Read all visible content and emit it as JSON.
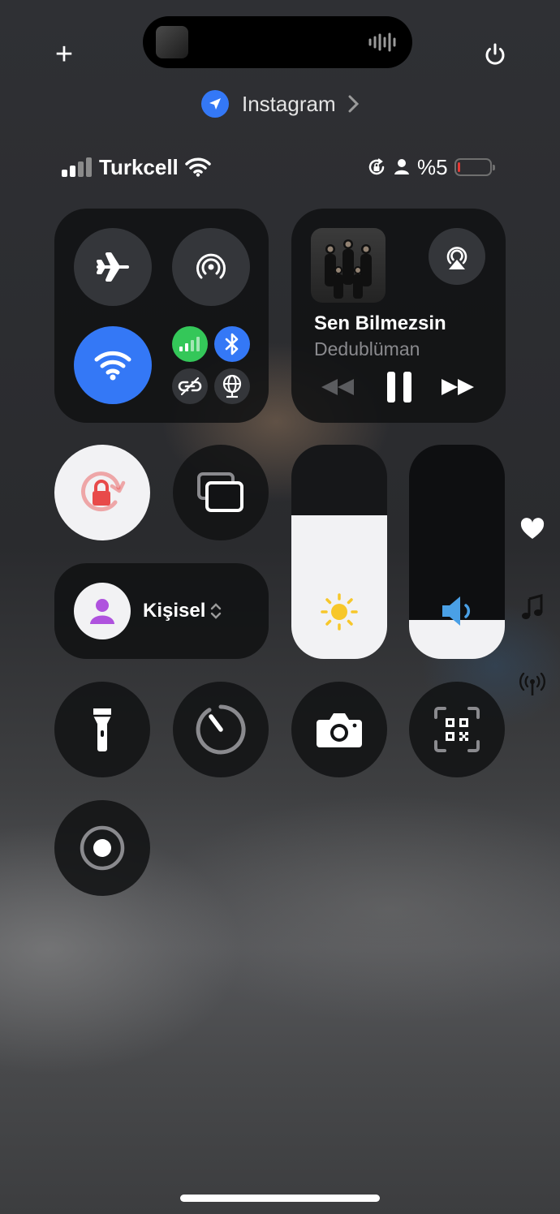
{
  "top_bar": {
    "add_label": "+",
    "power_icon": "power-icon"
  },
  "dynamic_island": {
    "artwork_icon": "album-artwork",
    "waveform_icon": "waveform-icon"
  },
  "location": {
    "app_name": "Instagram",
    "icon": "location-arrow-icon"
  },
  "status_bar": {
    "carrier": "Turkcell",
    "battery_text": "%5",
    "battery_level_percent": 5,
    "battery_color": "#e53935"
  },
  "connectivity": {
    "airplane_icon": "airplane-icon",
    "airdrop_icon": "airdrop-icon",
    "wifi_icon": "wifi-icon",
    "cellular_icon": "cellular-icon",
    "bluetooth_icon": "bluetooth-icon",
    "hotspot_icon": "personal-hotspot-icon",
    "vpn_icon": "vpn-globe-icon",
    "wifi_color": "#3478f6",
    "cellular_color": "#34c759",
    "bluetooth_color": "#3478f6"
  },
  "now_playing": {
    "title": "Sen Bilmezsin",
    "artist": "Dedublüman",
    "airplay_icon": "airplay-icon",
    "prev_icon": "rewind-icon",
    "play_icon": "pause-icon",
    "next_icon": "fast-forward-icon"
  },
  "focus": {
    "label": "Kişisel",
    "icon": "person-icon",
    "accent": "#af52de"
  },
  "sliders": {
    "brightness_level_percent": 67,
    "volume_level_percent": 18,
    "brightness_icon": "sun-icon",
    "volume_icon": "speaker-icon"
  },
  "side_icons": [
    "heart-icon",
    "music-note-icon",
    "antenna-icon"
  ],
  "controls": [
    "flashlight-icon",
    "timer-icon",
    "camera-icon",
    "qr-code-icon",
    "screen-record-icon"
  ],
  "rotation_lock": {
    "icon": "rotation-lock-icon",
    "accent": "#e84a4a"
  }
}
